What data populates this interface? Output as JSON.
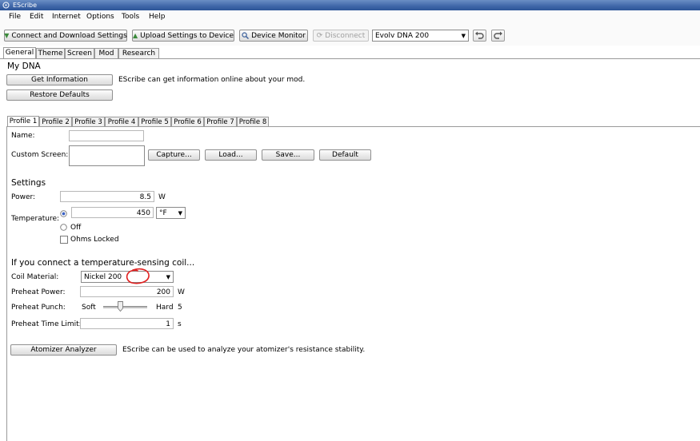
{
  "window": {
    "title": "EScribe"
  },
  "menu": [
    "File",
    "Edit",
    "Internet",
    "Options",
    "Tools",
    "Help"
  ],
  "toolbar": {
    "connect_label": "Connect and Download Settings",
    "upload_label": "Upload Settings to Device",
    "monitor_label": "Device Monitor",
    "disconnect_label": "Disconnect",
    "device_select": "Evolv DNA 200"
  },
  "main_tabs": [
    "General",
    "Theme",
    "Screen",
    "Mod",
    "Research"
  ],
  "general": {
    "heading": "My DNA",
    "get_info_label": "Get Information",
    "get_info_desc": "EScribe can get information online about your mod.",
    "restore_label": "Restore Defaults"
  },
  "profile_tabs": [
    "Profile 1",
    "Profile 2",
    "Profile 3",
    "Profile 4",
    "Profile 5",
    "Profile 6",
    "Profile 7",
    "Profile 8"
  ],
  "profile": {
    "name_label": "Name:",
    "name_value": "",
    "custom_screen_label": "Custom Screen:",
    "capture_label": "Capture...",
    "load_label": "Load...",
    "save_label": "Save...",
    "default_label": "Default"
  },
  "settings": {
    "heading": "Settings",
    "power_label": "Power:",
    "power_value": "8.5",
    "power_unit": "W",
    "temperature_label": "Temperature:",
    "temperature_value": "450",
    "temperature_unit": "°F",
    "temp_mode_selected": "temperature",
    "off_label": "Off",
    "ohms_locked_label": "Ohms Locked",
    "ohms_locked_checked": false
  },
  "coil": {
    "heading": "If you connect a temperature-sensing coil...",
    "material_label": "Coil Material:",
    "material_value": "Nickel 200",
    "preheat_power_label": "Preheat Power:",
    "preheat_power_value": "200",
    "preheat_power_unit": "W",
    "preheat_punch_label": "Preheat Punch:",
    "punch_soft": "Soft",
    "punch_hard": "Hard",
    "punch_value": "5",
    "preheat_time_label": "Preheat Time Limit:",
    "preheat_time_value": "1",
    "preheat_time_unit": "s"
  },
  "atomizer": {
    "button_label": "Atomizer Analyzer",
    "desc": "EScribe can be used to analyze your atomizer's resistance stability."
  },
  "colors": {
    "titlebar": "#3f66a8",
    "annotation": "#e02020"
  }
}
